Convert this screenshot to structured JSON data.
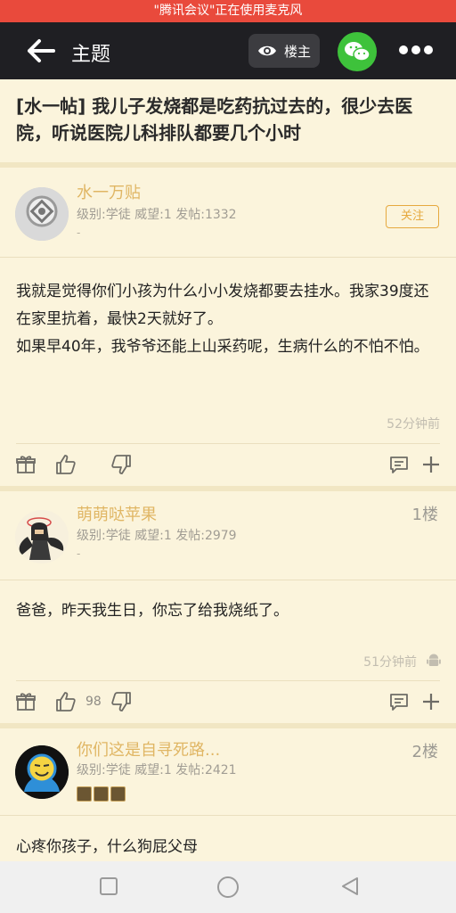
{
  "status_bar": {
    "recording_text": "\"腾讯会议\"正在使用麦克风"
  },
  "nav": {
    "back_icon": "arrow-left-icon",
    "title": "主题",
    "op_only_label": "楼主",
    "wechat_icon": "wechat-icon",
    "more_icon": "more-dots-icon"
  },
  "thread": {
    "title": "[水一帖] 我儿子发烧都是吃药抗过去的，很少去医院，听说医院儿科排队都要几个小时"
  },
  "posts": [
    {
      "username": "水一万贴",
      "meta": "级别:学徒 威望:1 发帖:1332",
      "sub": "-",
      "follow_label": "关注",
      "content": [
        "我就是觉得你们小孩为什么小小发烧都要去挂水。我家39度还在家里抗着，最快2天就好了。",
        "如果早40年，我爷爷还能上山采药呢，生病什么的不怕不怕。"
      ],
      "time": "52分钟前"
    },
    {
      "username": "萌萌哒苹果",
      "floor": "1楼",
      "meta": "级别:学徒 威望:1 发帖:2979",
      "sub": "-",
      "content": [
        "爸爸，昨天我生日，你忘了给我烧纸了。"
      ],
      "time": "51分钟前",
      "likes": "98"
    },
    {
      "username": "你们这是自寻死路...",
      "floor": "2楼",
      "meta": "级别:学徒 威望:1 发帖:2421",
      "content": [
        "心疼你孩子，什么狗屁父母"
      ]
    }
  ],
  "system_nav": {
    "icons": [
      "square-icon",
      "circle-icon",
      "triangle-back-icon"
    ]
  }
}
